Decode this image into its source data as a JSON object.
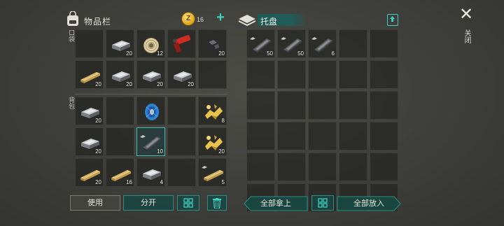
{
  "inventory": {
    "title": "物品栏",
    "coin_symbol": "Z",
    "coin_count": "16",
    "pocket_label": "口袋",
    "backpack_label": "背包",
    "pocket_slots": [
      {
        "item": "",
        "count": ""
      },
      {
        "item": "iron-ingot",
        "count": "20"
      },
      {
        "item": "rope-coil",
        "count": "12"
      },
      {
        "item": "flare-gun",
        "count": ""
      },
      {
        "item": "coal",
        "count": "20"
      },
      {
        "item": "wood-plank",
        "count": "20"
      },
      {
        "item": "iron-ingot",
        "count": "20"
      },
      {
        "item": "iron-ingot",
        "count": "20"
      },
      {
        "item": "iron-ingot",
        "count": "20"
      },
      {
        "item": "",
        "count": ""
      }
    ],
    "backpack_slots": [
      {
        "item": "iron-ingot",
        "count": "20"
      },
      {
        "item": "",
        "count": ""
      },
      {
        "item": "wire-spool",
        "count": ""
      },
      {
        "item": "",
        "count": ""
      },
      {
        "item": "gold-scrap",
        "count": "8"
      },
      {
        "item": "iron-ingot",
        "count": "20"
      },
      {
        "item": "",
        "count": ""
      },
      {
        "item": "steel-bar",
        "count": "10"
      },
      {
        "item": "",
        "count": ""
      },
      {
        "item": "gold-scrap",
        "count": "20"
      },
      {
        "item": "wood-plank",
        "count": "20"
      },
      {
        "item": "wood-plank",
        "count": "16"
      },
      {
        "item": "iron-ingot",
        "count": "4"
      },
      {
        "item": "",
        "count": ""
      },
      {
        "item": "wood-plank",
        "count": "5"
      }
    ]
  },
  "tray": {
    "title": "托盘",
    "slots": [
      {
        "item": "steel-bar",
        "count": "50"
      },
      {
        "item": "steel-bar",
        "count": "50"
      },
      {
        "item": "steel-bar",
        "count": "6"
      }
    ]
  },
  "close_label": "关闭",
  "buttons": {
    "use": "使用",
    "split": "分开",
    "take_all": "全部拿上",
    "put_all": "全部放入"
  },
  "colors": {
    "accent": "#3fd0c0",
    "button_bg": "#19463f",
    "selected_border": "#3fb8b0"
  }
}
